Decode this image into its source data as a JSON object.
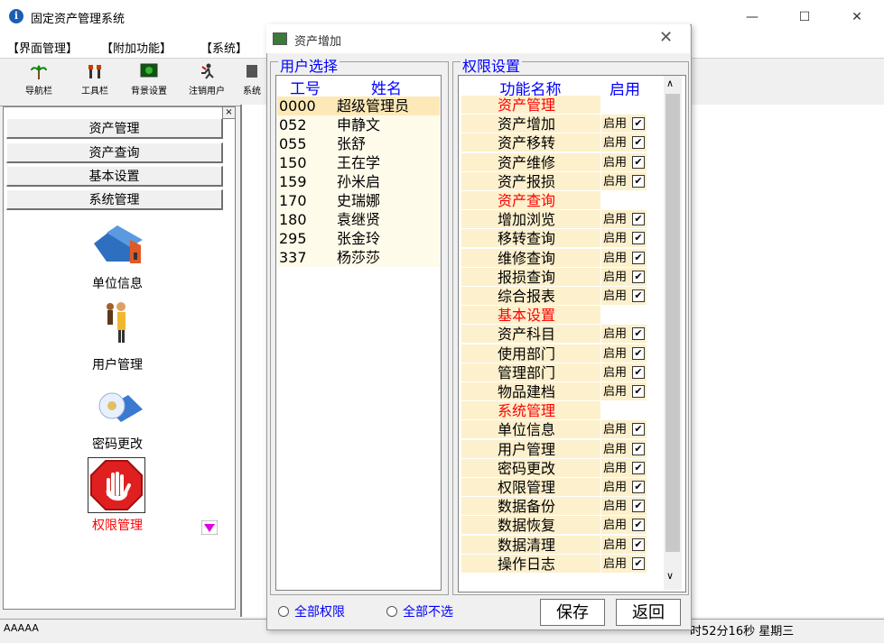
{
  "window": {
    "title": "固定资产管理系统",
    "minimize": "—",
    "maximize": "☐",
    "close": "✕"
  },
  "menu": [
    "【界面管理】",
    "【附加功能】",
    "【系统】"
  ],
  "toolbar": [
    {
      "label": "导航栏",
      "icon": "palm-tree-icon"
    },
    {
      "label": "工具栏",
      "icon": "tools-icon"
    },
    {
      "label": "背景设置",
      "icon": "background-icon"
    },
    {
      "label": "注销用户",
      "icon": "logout-icon"
    },
    {
      "label": "系统",
      "icon": "system-icon"
    }
  ],
  "nav": {
    "close": "×",
    "buttons": [
      "资产管理",
      "资产查询",
      "基本设置",
      "系统管理"
    ],
    "items": [
      {
        "label": "单位信息",
        "icon": "house-icon",
        "active": false
      },
      {
        "label": "用户管理",
        "icon": "users-icon",
        "active": false
      },
      {
        "label": "密码更改",
        "icon": "password-disc-icon",
        "active": false
      },
      {
        "label": "权限管理",
        "icon": "stop-hand-icon",
        "active": true
      }
    ]
  },
  "status": {
    "left": "AAAAA",
    "time": "时52分16秒 星期三"
  },
  "dialog": {
    "title": "资产增加",
    "close": "✕",
    "user_group": "用户选择",
    "perm_group": "权限设置",
    "user_columns": [
      "工号",
      "姓名"
    ],
    "users": [
      {
        "id": "0000",
        "name": "超级管理员",
        "selected": true
      },
      {
        "id": "052",
        "name": "申静文",
        "selected": false
      },
      {
        "id": "055",
        "name": "张舒",
        "selected": false
      },
      {
        "id": "150",
        "name": "王在学",
        "selected": false
      },
      {
        "id": "159",
        "name": "孙米启",
        "selected": false
      },
      {
        "id": "170",
        "name": "史瑞娜",
        "selected": false
      },
      {
        "id": "180",
        "name": "袁继贤",
        "selected": false
      },
      {
        "id": "295",
        "name": "张金玲",
        "selected": false
      },
      {
        "id": "337",
        "name": "杨莎莎",
        "selected": false
      }
    ],
    "perm_columns": [
      "功能名称",
      "启用"
    ],
    "permissions": [
      {
        "name": "资产管理",
        "category": true
      },
      {
        "name": "资产增加",
        "enable": "启用",
        "checked": true
      },
      {
        "name": "资产移转",
        "enable": "启用",
        "checked": true
      },
      {
        "name": "资产维修",
        "enable": "启用",
        "checked": true
      },
      {
        "name": "资产报损",
        "enable": "启用",
        "checked": true
      },
      {
        "name": "资产查询",
        "category": true
      },
      {
        "name": "增加浏览",
        "enable": "启用",
        "checked": true
      },
      {
        "name": "移转查询",
        "enable": "启用",
        "checked": true
      },
      {
        "name": "维修查询",
        "enable": "启用",
        "checked": true
      },
      {
        "name": "报损查询",
        "enable": "启用",
        "checked": true
      },
      {
        "name": "综合报表",
        "enable": "启用",
        "checked": true
      },
      {
        "name": "基本设置",
        "category": true
      },
      {
        "name": "资产科目",
        "enable": "启用",
        "checked": true
      },
      {
        "name": "使用部门",
        "enable": "启用",
        "checked": true
      },
      {
        "name": "管理部门",
        "enable": "启用",
        "checked": true
      },
      {
        "name": "物品建档",
        "enable": "启用",
        "checked": true
      },
      {
        "name": "系统管理",
        "category": true
      },
      {
        "name": "单位信息",
        "enable": "启用",
        "checked": true
      },
      {
        "name": "用户管理",
        "enable": "启用",
        "checked": true
      },
      {
        "name": "密码更改",
        "enable": "启用",
        "checked": true
      },
      {
        "name": "权限管理",
        "enable": "启用",
        "checked": true
      },
      {
        "name": "数据备份",
        "enable": "启用",
        "checked": true
      },
      {
        "name": "数据恢复",
        "enable": "启用",
        "checked": true
      },
      {
        "name": "数据清理",
        "enable": "启用",
        "checked": true
      },
      {
        "name": "操作日志",
        "enable": "启用",
        "checked": true
      }
    ],
    "radio_all": "全部权限",
    "radio_none": "全部不选",
    "save": "保存",
    "back": "返回",
    "scroll_up": "∧",
    "scroll_down": "∨"
  }
}
